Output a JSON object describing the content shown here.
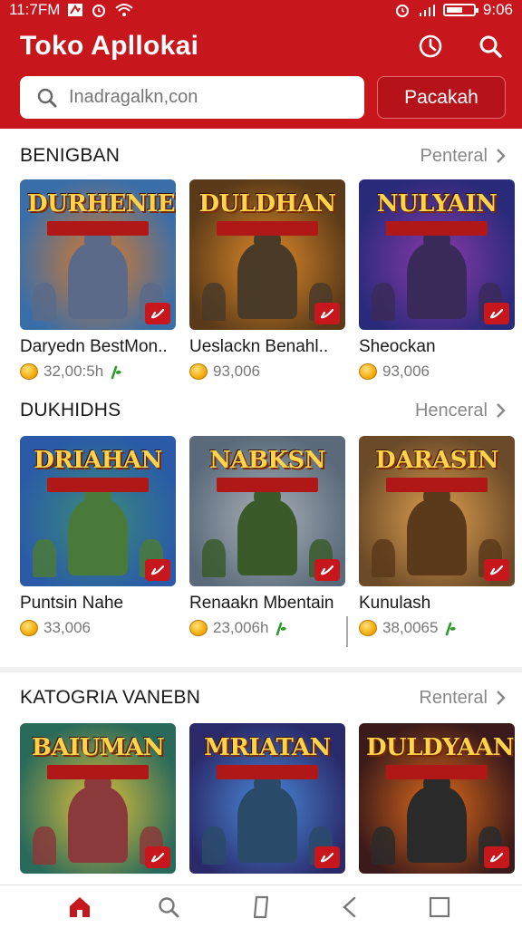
{
  "status_bar": {
    "time": "11:7FM",
    "time_right": "9:06",
    "battery_level": 0.6
  },
  "header": {
    "title": "Toko Apllokai",
    "search_placeholder": "Inadragalkn,con",
    "search_button": "Pacakah",
    "history_icon": "history-icon",
    "search_icon": "search-icon",
    "accent_color": "#c8161d"
  },
  "sections": [
    {
      "title": "BENIGBAN",
      "see_all": "Penteral",
      "apps": [
        {
          "name": "Daryedn BestMon..",
          "rating": "32,00:5h",
          "has_leaf": true,
          "banner": "DURHENIEN",
          "colors": {
            "bg1": "#3a6ea8",
            "bg2": "#d97a2a",
            "hero": "#5a6a88"
          }
        },
        {
          "name": "Ueslackn Benahl..",
          "rating": "93,006",
          "has_leaf": false,
          "banner": "DULDHAN",
          "colors": {
            "bg1": "#5a3a18",
            "bg2": "#e08a2a",
            "hero": "#4a3a28"
          }
        },
        {
          "name": "Sheockan",
          "rating": "93,006",
          "has_leaf": false,
          "banner": "NULYAIN",
          "colors": {
            "bg1": "#2a2a7a",
            "bg2": "#8a3aa8",
            "hero": "#3a2a5a"
          }
        }
      ]
    },
    {
      "title": "DUKHIDHS",
      "see_all": "Henceral",
      "apps": [
        {
          "name": "Puntsin Nahe",
          "rating": "33,006",
          "has_leaf": false,
          "banner": "DRIAHAN",
          "colors": {
            "bg1": "#2a5aa8",
            "bg2": "#3a8a7a",
            "hero": "#4a7a3a"
          }
        },
        {
          "name": "Renaakn Mbentain",
          "rating": "23,006h",
          "has_leaf": true,
          "banner": "NABKSN",
          "colors": {
            "bg1": "#5a6a7a",
            "bg2": "#a8b0b8",
            "hero": "#3a5a2a"
          }
        },
        {
          "name": "Kunulash",
          "rating": "38,0065",
          "has_leaf": true,
          "banner": "DARASIN",
          "colors": {
            "bg1": "#6a4a28",
            "bg2": "#e0a050",
            "hero": "#5a3a1a"
          }
        }
      ]
    },
    {
      "title": "KATOGRIA VANEBN",
      "see_all": "Renteral",
      "apps": [
        {
          "banner": "BAIUMAN",
          "colors": {
            "bg1": "#2a6a5a",
            "bg2": "#e0c03a",
            "hero": "#8a3a3a"
          }
        },
        {
          "banner": "MRIATAN",
          "colors": {
            "bg1": "#2a2a6a",
            "bg2": "#4a8ad8",
            "hero": "#2a4a6a"
          }
        },
        {
          "banner": "DULDYAAN",
          "colors": {
            "bg1": "#3a1a1a",
            "bg2": "#e06a1a",
            "hero": "#2a2a2a"
          }
        }
      ]
    }
  ],
  "bottom_nav": [
    {
      "icon": "home-icon",
      "active": true
    },
    {
      "icon": "search-icon",
      "active": false
    },
    {
      "icon": "bookmark-icon",
      "active": false
    },
    {
      "icon": "back-icon",
      "active": false
    },
    {
      "icon": "square-icon",
      "active": false
    }
  ]
}
